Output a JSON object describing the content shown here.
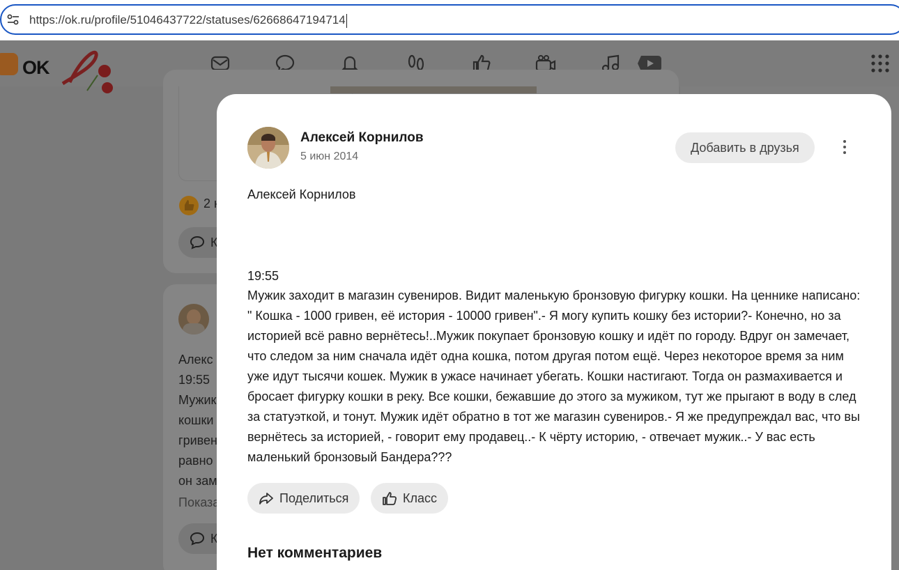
{
  "browser": {
    "url": "https://ok.ru/profile/51046437722/statuses/62668647194714"
  },
  "background": {
    "logo_text": "OK",
    "likes_count": "2 н",
    "comment_button_partial": "К",
    "post_preview_lines": [
      "Алекс",
      "19:55",
      "Мужик",
      "кошки",
      "гривен",
      "равно",
      "он зам"
    ],
    "show_more_partial": "Показа",
    "comment_button_partial_2": "К"
  },
  "nav": {
    "icons": [
      "mail-icon",
      "chat-icon",
      "bell-icon",
      "footprints-icon",
      "like-icon",
      "video-camera-icon",
      "music-icon",
      "video-icon"
    ]
  },
  "post": {
    "author": "Алексей Корнилов",
    "date": "5 июн 2014",
    "add_friend_label": "Добавить в друзья",
    "headline": "Алексей Корнилов",
    "time": "19:55",
    "text": "Мужик заходит в магазин сувениров. Видит маленькую бронзовую фигурку кошки. На ценнике написано: \" Кошка - 1000 гривен, её история - 10000 гривен\".- Я могу купить кошку без истории?- Конечно, но за историей всё равно вернётесь!..Мужик покупает бронзовую кошку и идёт по городу. Вдруг он замечает, что следом за ним сначала идёт одна кошка, потом другая потом ещё. Через некоторое время за ним уже идут тысячи кошек. Мужик в ужасе начинает убегать. Кошки настигают. Тогда он размахивается и бросает фигурку кошки в реку. Все кошки, бежавшие до этого за мужиком, тут же прыгают в воду в след за статуэткой, и тонут. Мужик идёт обратно в тот же магазин сувениров.- Я же предупреждал вас, что вы вернётесь за историей, - говорит ему продавец..- К чёрту историю, - отвечает мужик..- У вас есть маленький бронзовый Бандера???",
    "share_label": "Поделиться",
    "like_label": "Класс",
    "comments_heading": "Нет комментариев"
  }
}
